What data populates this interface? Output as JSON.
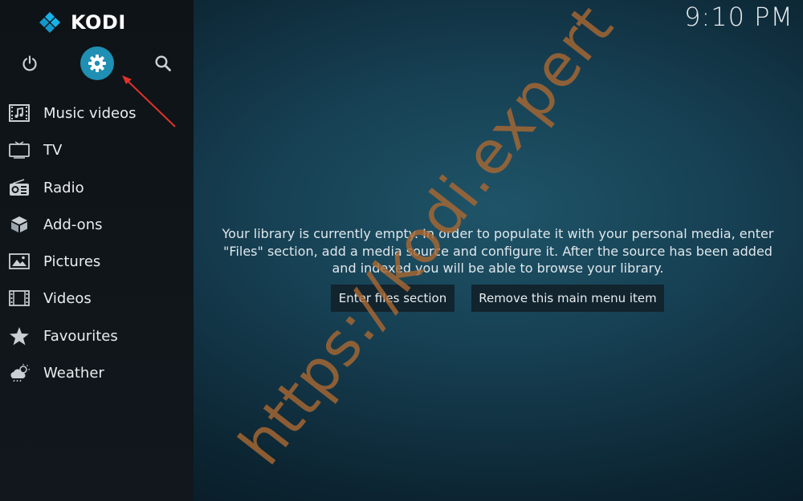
{
  "app": {
    "name": "KODI"
  },
  "clock": {
    "time": "9:10 PM"
  },
  "top_buttons": [
    {
      "name": "power",
      "icon": "power-icon"
    },
    {
      "name": "settings",
      "icon": "gear-icon",
      "highlight_color": "#1f8fb3"
    },
    {
      "name": "search",
      "icon": "search-icon"
    }
  ],
  "sidebar": {
    "items": [
      {
        "label": "Music videos",
        "icon": "music-video-icon"
      },
      {
        "label": "TV",
        "icon": "tv-icon"
      },
      {
        "label": "Radio",
        "icon": "radio-icon"
      },
      {
        "label": "Add-ons",
        "icon": "addons-box-icon"
      },
      {
        "label": "Pictures",
        "icon": "picture-icon"
      },
      {
        "label": "Videos",
        "icon": "film-strip-icon"
      },
      {
        "label": "Favourites",
        "icon": "star-icon"
      },
      {
        "label": "Weather",
        "icon": "weather-cloud-icon"
      }
    ]
  },
  "main": {
    "message_line1": "Your library is currently empty. In order to populate it with your personal media, enter",
    "message_line2": "\"Files\" section, add a media source and configure it. After the source has been added",
    "message_line3": "and indexed you will be able to browse your library.",
    "enter_files_label": "Enter files section",
    "remove_item_label": "Remove this main menu item"
  },
  "watermark": {
    "text": "https://kodi.expert"
  },
  "colors": {
    "accent": "#1f8fb3",
    "arrow": "#e0322c",
    "watermark": "#a86832"
  }
}
